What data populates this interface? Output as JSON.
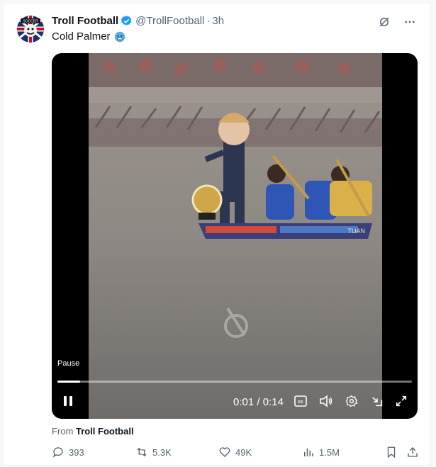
{
  "tweet": {
    "author_name": "Troll Football",
    "handle": "@TrollFootball",
    "separator": "·",
    "time": "3h",
    "text": "Cold Palmer",
    "emoji_icon": "cold-face-icon",
    "avatar_text": "SOCCER"
  },
  "video": {
    "tooltip": "Pause",
    "current_time": "0:01",
    "time_sep": "/",
    "duration": "0:14",
    "progress_fraction": 0.064,
    "boat_label_left": "",
    "boat_label_right": "TUAN"
  },
  "from": {
    "prefix": "From",
    "source": "Troll Football"
  },
  "actions": {
    "replies": "393",
    "reposts": "5.3K",
    "likes": "49K",
    "views": "1.5M"
  },
  "colors": {
    "verified": "#1d9bf0",
    "text_secondary": "#536471",
    "water": "#8f8a84",
    "crowd": "#7d6f6d"
  }
}
